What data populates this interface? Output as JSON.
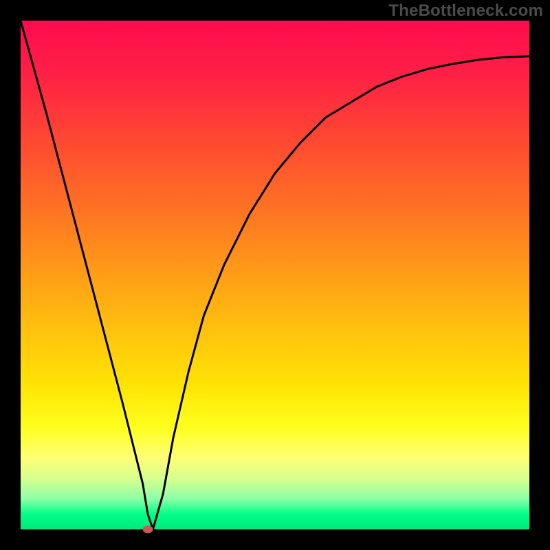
{
  "watermark": "TheBottleneck.com",
  "chart_data": {
    "type": "line",
    "title": "",
    "xlabel": "",
    "ylabel": "",
    "xlim": [
      0,
      100
    ],
    "ylim": [
      0,
      100
    ],
    "grid": false,
    "legend": false,
    "background_gradient": {
      "top": "#ff0b4e",
      "mid": "#ffd000",
      "bottom": "#00ff88"
    },
    "series": [
      {
        "name": "bottleneck-curve",
        "color": "#000000",
        "x": [
          0,
          5,
          10,
          15,
          20,
          22,
          24,
          25,
          26,
          28,
          30,
          33,
          36,
          40,
          45,
          50,
          55,
          60,
          65,
          70,
          75,
          80,
          85,
          90,
          95,
          100
        ],
        "y": [
          100,
          82,
          63,
          44,
          25,
          17,
          9,
          3,
          0,
          7,
          18,
          31,
          42,
          52,
          62,
          70,
          76,
          81,
          84,
          87,
          89,
          90.5,
          91.5,
          92.3,
          92.8,
          93
        ]
      }
    ],
    "minimum_marker": {
      "x": 25,
      "y": 0,
      "color": "#c85a54"
    }
  }
}
